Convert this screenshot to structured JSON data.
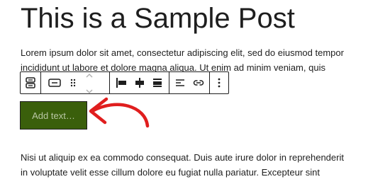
{
  "post": {
    "title": "This is a Sample Post",
    "paragraph_1_line_1": "Lorem ipsum dolor sit amet, consectetur adipiscing elit, sed do eiusmod tempor",
    "paragraph_1_line_2": "incididunt ut labore et dolore magna aliqua. Ut enim ad minim veniam, quis",
    "paragraph_2_line_1": "Nisi ut aliquip ex ea commodo consequat. Duis aute irure dolor in reprehenderit",
    "paragraph_2_line_2": "in voluptate velit esse cillum dolore eu fugiat nulla pariatur. Excepteur sint"
  },
  "toolbar": {
    "icons": [
      "buttons-block-icon",
      "button-block-icon",
      "drag-handle-icon",
      "move-up-icon",
      "move-down-icon",
      "justify-left-icon",
      "justify-center-icon",
      "justify-space-between-icon",
      "text-align-icon",
      "link-icon",
      "more-options-icon"
    ]
  },
  "button_block": {
    "placeholder": "Add text…",
    "background_color": "#3a5f0b",
    "text_color": "#b9c7a4"
  },
  "annotation": {
    "arrow_color": "#e01e1e"
  }
}
